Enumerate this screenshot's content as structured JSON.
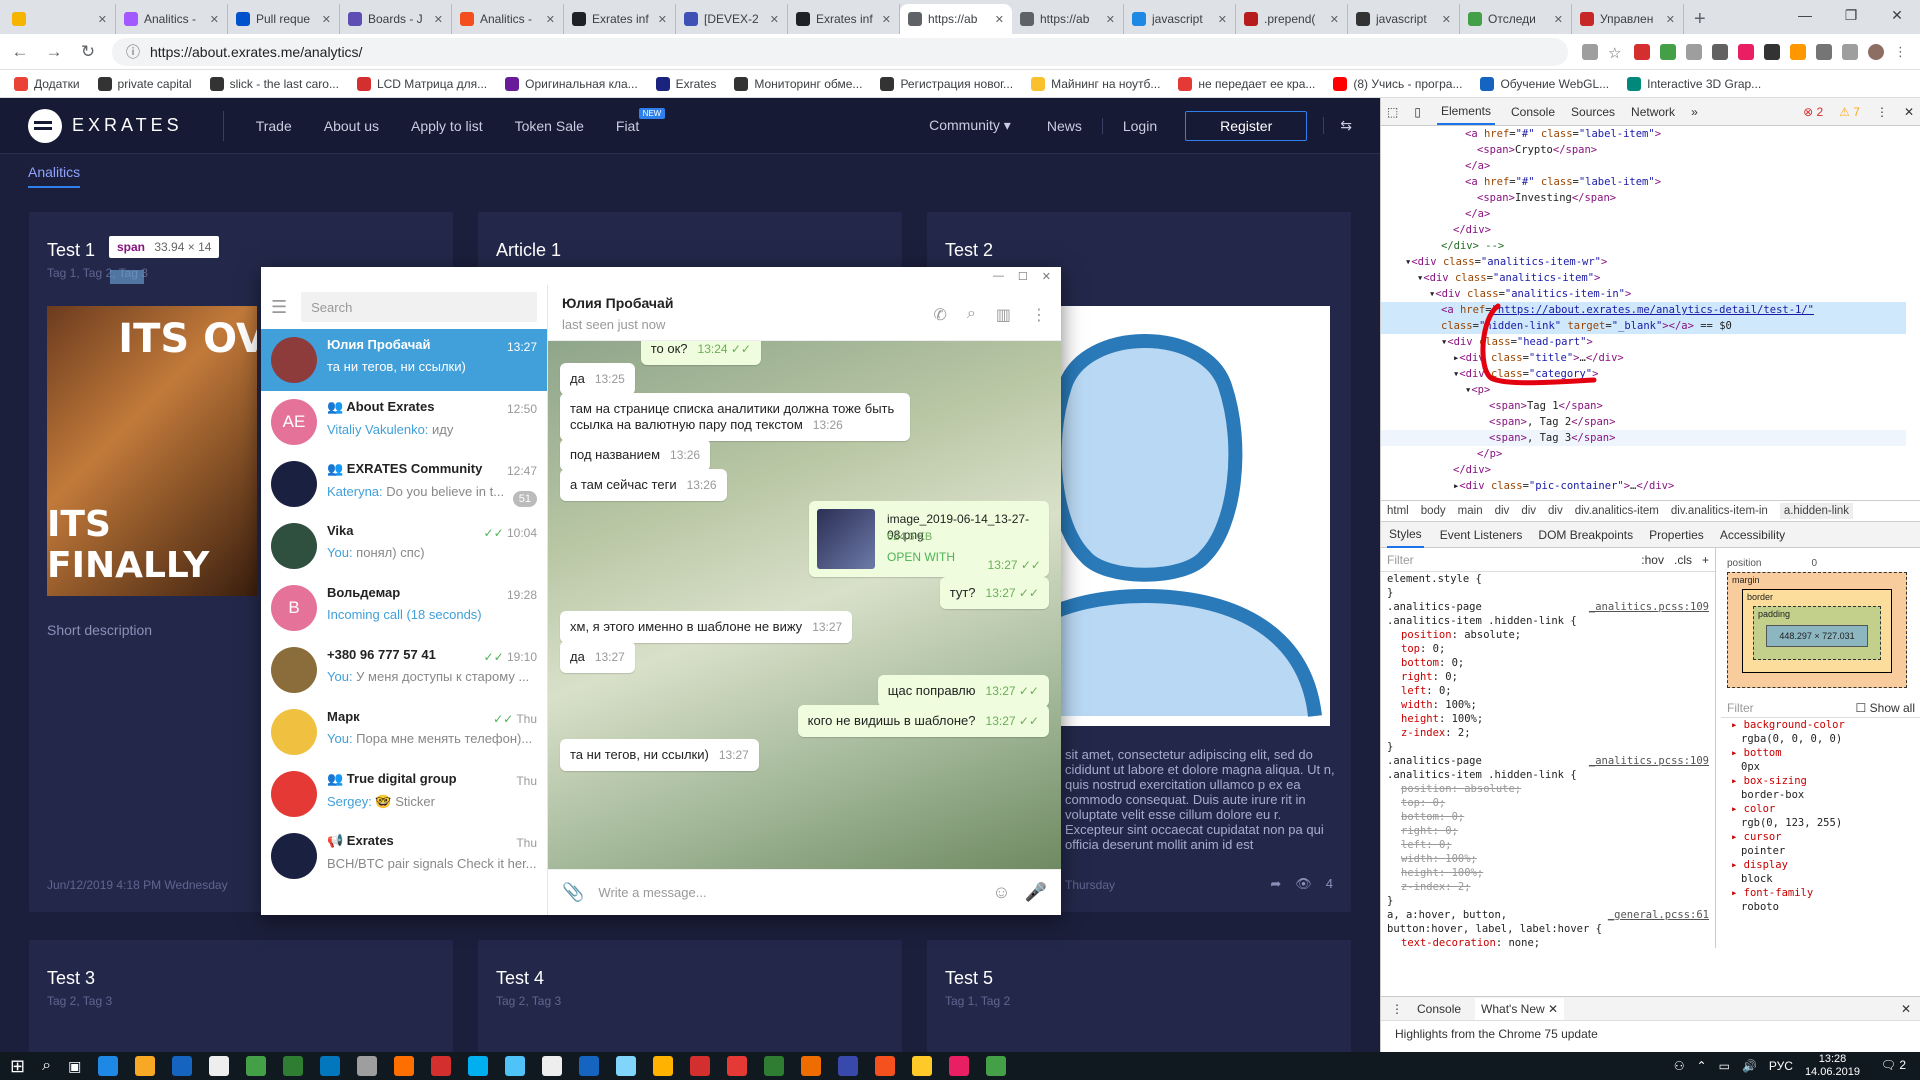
{
  "browser": {
    "tabs": [
      {
        "title": "",
        "color": "#f4b400"
      },
      {
        "title": "Analitics -",
        "color": "#a259ff"
      },
      {
        "title": "Pull reque",
        "color": "#0052cc"
      },
      {
        "title": "Boards - J",
        "color": "#5e4db2"
      },
      {
        "title": "Analitics -",
        "color": "#f24e1e"
      },
      {
        "title": "Exrates inf",
        "color": "#202124"
      },
      {
        "title": "[DEVEX-2",
        "color": "#3f51b5"
      },
      {
        "title": "Exrates inf",
        "color": "#202124"
      },
      {
        "title": "https://ab",
        "color": "#5f6368",
        "active": true
      },
      {
        "title": "https://ab",
        "color": "#5f6368"
      },
      {
        "title": "javascript",
        "color": "#1e88e5"
      },
      {
        "title": ".prepend(",
        "color": "#b71c1c"
      },
      {
        "title": "javascript",
        "color": "#333333"
      },
      {
        "title": "Отследи",
        "color": "#43a047"
      },
      {
        "title": "Управлен",
        "color": "#c62828"
      }
    ],
    "url": "https://about.exrates.me/analytics/",
    "bookmarks": [
      {
        "label": "Додатки",
        "color": "#ea4335"
      },
      {
        "label": "private capital",
        "color": "#333333"
      },
      {
        "label": "slick - the last caro...",
        "color": "#333333"
      },
      {
        "label": "LCD Матрица для...",
        "color": "#d32f2f"
      },
      {
        "label": "Оригинальная кла...",
        "color": "#6a1b9a"
      },
      {
        "label": "Exrates",
        "color": "#1a237e"
      },
      {
        "label": "Мониторинг обме...",
        "color": "#333333"
      },
      {
        "label": "Регистрация новог...",
        "color": "#333333"
      },
      {
        "label": "Майнинг на ноутб...",
        "color": "#fbc02d"
      },
      {
        "label": "не передает ее кра...",
        "color": "#e53935"
      },
      {
        "label": "(8) Учись - програ...",
        "color": "#ff0000"
      },
      {
        "label": "Обучение WebGL...",
        "color": "#1565c0"
      },
      {
        "label": "Interactive 3D Grap...",
        "color": "#00897b"
      }
    ]
  },
  "site": {
    "logo": "EXRATES",
    "nav": [
      "Trade",
      "About us",
      "Apply to list",
      "Token Sale",
      "Fiat"
    ],
    "new_badge": "NEW",
    "nav_right": [
      "Community ▾",
      "News",
      "Login"
    ],
    "register": "Register",
    "subnav": "Analitics",
    "tooltip_tag": "span",
    "tooltip_dim": "33.94 × 14",
    "cards": [
      {
        "title": "Test 1",
        "tags": "Tag 1, Tag 2, Tag 3",
        "desc": "Short description",
        "date": "Jun/12/2019 4:18 PM Wednesday",
        "meme_top": "ITS OV",
        "meme_bottom": "ITS FINALLY"
      },
      {
        "title": "Article 1"
      },
      {
        "title": "Test 2",
        "body": "sit amet, consectetur adipiscing elit, sed do cididunt ut labore et dolore magna aliqua. Ut n, quis nostrud exercitation ullamco p ex ea commodo consequat. Duis aute irure rit in voluptate velit esse cillum dolore eu r. Excepteur sint occaecat cupidatat non pa qui officia deserunt mollit anim id est",
        "date": "Thursday",
        "views": "4"
      },
      {
        "title": "Test 3",
        "tags": "Tag 2, Tag 3"
      },
      {
        "title": "Test 4",
        "tags": "Tag 2, Tag 3"
      },
      {
        "title": "Test 5",
        "tags": "Tag 1, Tag 2"
      }
    ]
  },
  "telegram": {
    "search_placeholder": "Search",
    "header_name": "Юлия Пробачай",
    "header_status": "last seen just now",
    "input_placeholder": "Write a message...",
    "chats": [
      {
        "name": "Юлия Пробачай",
        "time": "13:27",
        "msg": "та ни тегов, ни ссылки)",
        "selected": true,
        "avatar_color": "#8d3b3b",
        "initials": ""
      },
      {
        "name": "About Exrates",
        "time": "12:50",
        "who": "Vitaliy Vakulenko:",
        "msg": " иду",
        "avatar_color": "#e57399",
        "initials": "AE",
        "group": true
      },
      {
        "name": "EXRATES Community",
        "time": "12:47",
        "who": "Kateryna:",
        "msg": " Do you believe in t...",
        "badge": "51",
        "avatar_color": "#1a2040",
        "initials": "",
        "group": true
      },
      {
        "name": "Vika",
        "time": "10:04",
        "who": "You:",
        "msg": " понял) спс)",
        "tick": "✓✓",
        "avatar_color": "#2f4f3f",
        "initials": ""
      },
      {
        "name": "Вольдемар",
        "time": "19:28",
        "msg": "Incoming call (18 seconds)",
        "avatar_color": "#e57399",
        "initials": "В",
        "call": true
      },
      {
        "name": "+380 96 777 57 41",
        "time": "19:10",
        "who": "You:",
        "msg": " У меня доступы к старому ...",
        "tick": "✓✓",
        "avatar_color": "#8a6d3b",
        "initials": ""
      },
      {
        "name": "Марк",
        "time": "Thu",
        "who": "You:",
        "msg": " Пора мне менять телефон)...",
        "tick": "✓✓",
        "avatar_color": "#f0c040",
        "initials": ""
      },
      {
        "name": "True digital group",
        "time": "Thu",
        "who": "Sergey:",
        "msg": " 🤓 Sticker",
        "avatar_color": "#e53935",
        "initials": "",
        "group": true
      },
      {
        "name": "Exrates",
        "time": "Thu",
        "msg": "BCH/BTC pair signals  Check it her...",
        "avatar_color": "#1a2040",
        "initials": "",
        "channel": true
      }
    ],
    "messages": [
      {
        "text": "то ок?",
        "time": "13:24",
        "out": true
      },
      {
        "text": "да",
        "time": "13:25"
      },
      {
        "text": "там на странице списка аналитики должна тоже быть ссылка на валютную пару под текстом",
        "time": "13:26"
      },
      {
        "text": "под названием",
        "time": "13:26"
      },
      {
        "text": "а там сейчас теги",
        "time": "13:26"
      },
      {
        "text": "image_2019-06-14_13-27-08.png",
        "size": "624.6 KB",
        "action": "OPEN WITH",
        "time": "13:27",
        "out": true,
        "file": true
      },
      {
        "text": "тут?",
        "time": "13:27",
        "out": true
      },
      {
        "text": "хм, я этого именно в шаблоне не вижу",
        "time": "13:27"
      },
      {
        "text": "да",
        "time": "13:27"
      },
      {
        "text": "щас поправлю",
        "time": "13:27",
        "out": true
      },
      {
        "text": "кого не видишь в шаблоне?",
        "time": "13:27",
        "out": true
      },
      {
        "text": "та ни тегов, ни ссылки)",
        "time": "13:27"
      }
    ]
  },
  "devtools": {
    "tabs": [
      "Elements",
      "Console",
      "Sources",
      "Network"
    ],
    "errors": "2",
    "warnings": "7",
    "dom_lines": [
      {
        "indent": 14,
        "html": "<span class='tg'>&lt;a</span> <span class='at'>href</span>=<span class='av2'>\"#\"</span> <span class='at'>class</span>=<span class='av2'>\"label-item\"</span><span class='tg'>&gt;</span>"
      },
      {
        "indent": 16,
        "html": "<span class='tg'>&lt;span&gt;</span>Crypto<span class='tg'>&lt;/span&gt;</span>"
      },
      {
        "indent": 14,
        "html": "<span class='tg'>&lt;/a&gt;</span>"
      },
      {
        "indent": 14,
        "html": "<span class='tg'>&lt;a</span> <span class='at'>href</span>=<span class='av2'>\"#\"</span> <span class='at'>class</span>=<span class='av2'>\"label-item\"</span><span class='tg'>&gt;</span>"
      },
      {
        "indent": 16,
        "html": "<span class='tg'>&lt;span&gt;</span>Investing<span class='tg'>&lt;/span&gt;</span>"
      },
      {
        "indent": 14,
        "html": "<span class='tg'>&lt;/a&gt;</span>"
      },
      {
        "indent": 12,
        "html": "<span class='tg'>&lt;/div&gt;</span>"
      },
      {
        "indent": 10,
        "html": "<span class='cm'>&lt;/div&gt; --&gt;</span>"
      },
      {
        "indent": 4,
        "html": "▾<span class='tg'>&lt;div</span> <span class='at'>class</span>=<span class='av2'>\"analitics-item-wr\"</span><span class='tg'>&gt;</span>"
      },
      {
        "indent": 6,
        "html": "▾<span class='tg'>&lt;div</span> <span class='at'>class</span>=<span class='av2'>\"analitics-item\"</span><span class='tg'>&gt;</span>"
      },
      {
        "indent": 8,
        "html": "▾<span class='tg'>&lt;div</span> <span class='at'>class</span>=<span class='av2'>\"analitics-item-in\"</span><span class='tg'>&gt;</span>"
      },
      {
        "indent": 10,
        "html": "<span class='tg'>&lt;a</span> <span class='at'>href</span>=<span class='av2' style='text-decoration:underline'>\"https://about.exrates.me/analytics-detail/test-1/\"</span>",
        "hl": true
      },
      {
        "indent": 10,
        "html": "<span class='at'>class</span>=<span class='av2'>\"hidden-link\"</span> <span class='at'>target</span>=<span class='av2'>\"_blank\"</span><span class='tg'>&gt;&lt;/a&gt;</span> == $0",
        "hl": true
      },
      {
        "indent": 10,
        "html": "▾<span class='tg'>&lt;div</span> <span class='at'>class</span>=<span class='av2'>\"head-part\"</span><span class='tg'>&gt;</span>"
      },
      {
        "indent": 12,
        "html": "▸<span class='tg'>&lt;div</span> <span class='at'>class</span>=<span class='av2'>\"title\"</span><span class='tg'>&gt;</span>…<span class='tg'>&lt;/div&gt;</span>"
      },
      {
        "indent": 12,
        "html": "▾<span class='tg'>&lt;div</span> <span class='at'>class</span>=<span class='av2'>\"category\"</span><span class='tg'>&gt;</span>"
      },
      {
        "indent": 14,
        "html": "▾<span class='tg'>&lt;p&gt;</span>"
      },
      {
        "indent": 18,
        "html": "<span class='tg'>&lt;span&gt;</span>Tag 1<span class='tg'>&lt;/span&gt;</span>"
      },
      {
        "indent": 18,
        "html": "<span class='tg'>&lt;span&gt;</span>, Tag 2<span class='tg'>&lt;/span&gt;</span>"
      },
      {
        "indent": 18,
        "html": "<span class='tg'>&lt;span&gt;</span>, Tag 3<span class='tg'>&lt;/span&gt;</span>",
        "hover": true
      },
      {
        "indent": 16,
        "html": "<span class='tg'>&lt;/p&gt;</span>"
      },
      {
        "indent": 12,
        "html": "<span class='tg'>&lt;/div&gt;</span>"
      },
      {
        "indent": 12,
        "html": "▸<span class='tg'>&lt;div</span> <span class='at'>class</span>=<span class='av2'>\"pic-container\"</span><span class='tg'>&gt;</span>…<span class='tg'>&lt;/div&gt;</span>"
      }
    ],
    "breadcrumbs": [
      "html",
      "body",
      "main",
      "div",
      "div",
      "div",
      "div.analitics-item",
      "div.analitics-item-in",
      "a.hidden-link"
    ],
    "style_tabs": [
      "Styles",
      "Event Listeners",
      "DOM Breakpoints",
      "Properties",
      "Accessibility"
    ],
    "filter_placeholder": "Filter",
    "hov": ":hov",
    "cls": ".cls",
    "rules": [
      {
        "sel": "element.style {",
        "src": "",
        "props": []
      },
      {
        "sel": ".analitics-page",
        "src": "_analitics.pcss:109",
        "sel2": ".analitics-item .hidden-link {",
        "props": [
          [
            "position",
            "absolute"
          ],
          [
            "top",
            "0"
          ],
          [
            "bottom",
            "0"
          ],
          [
            "right",
            "0"
          ],
          [
            "left",
            "0"
          ],
          [
            "width",
            "100%"
          ],
          [
            "height",
            "100%"
          ],
          [
            "z-index",
            "2"
          ]
        ]
      },
      {
        "sel": ".analitics-page",
        "src": "_analitics.pcss:109",
        "sel2": ".analitics-item .hidden-link {",
        "strike": true,
        "props": [
          [
            "position",
            "absolute"
          ],
          [
            "top",
            "0"
          ],
          [
            "bottom",
            "0"
          ],
          [
            "right",
            "0"
          ],
          [
            "left",
            "0"
          ],
          [
            "width",
            "100%"
          ],
          [
            "height",
            "100%"
          ],
          [
            "z-index",
            "2"
          ]
        ]
      },
      {
        "sel": "a, a:hover, button,",
        "src": "_general.pcss:61",
        "sel2": "button:hover, label, label:hover {",
        "props": [
          [
            "text-decoration",
            "none"
          ]
        ]
      }
    ],
    "box": {
      "position_label": "position",
      "position_val": "0",
      "margin": "margin",
      "border": "border",
      "padding": "padding",
      "dash": "–",
      "content": "448.297 × 727.031"
    },
    "computed_filter": "Filter",
    "show_all": "Show all",
    "computed": [
      [
        "background-color",
        "rgba(0, 0, 0, 0)"
      ],
      [
        "bottom",
        "0px"
      ],
      [
        "box-sizing",
        "border-box"
      ],
      [
        "color",
        "rgb(0, 123, 255)"
      ],
      [
        "cursor",
        "pointer"
      ],
      [
        "display",
        "block"
      ],
      [
        "font-family",
        "roboto"
      ]
    ],
    "drawer_tabs": [
      "Console",
      "What's New"
    ],
    "drawer_msg": "Highlights from the Chrome 75 update"
  },
  "taskbar": {
    "lang": "РУС",
    "time": "13:28",
    "date": "14.06.2019",
    "notif": "2",
    "icons": [
      "#1e88e5",
      "#f9a825",
      "#1565c0",
      "#eeeeee",
      "#43a047",
      "#2e7d32",
      "#0277bd",
      "#9e9e9e",
      "#ff6f00",
      "#d32f2f",
      "#00aff0",
      "#4fc3f7",
      "#eeeeee",
      "#1565c0",
      "#81d4fa",
      "#ffb300",
      "#d32f2f",
      "#e53935",
      "#2e7d32",
      "#ef6c00",
      "#3949ab",
      "#f4511e",
      "#ffca28",
      "#e91e63",
      "#43a047"
    ]
  },
  "colors": {
    "accent": "#2f80ed",
    "site_bg": "#1b1f3b",
    "card_bg": "#23284a",
    "tg_blue": "#419fd9"
  }
}
